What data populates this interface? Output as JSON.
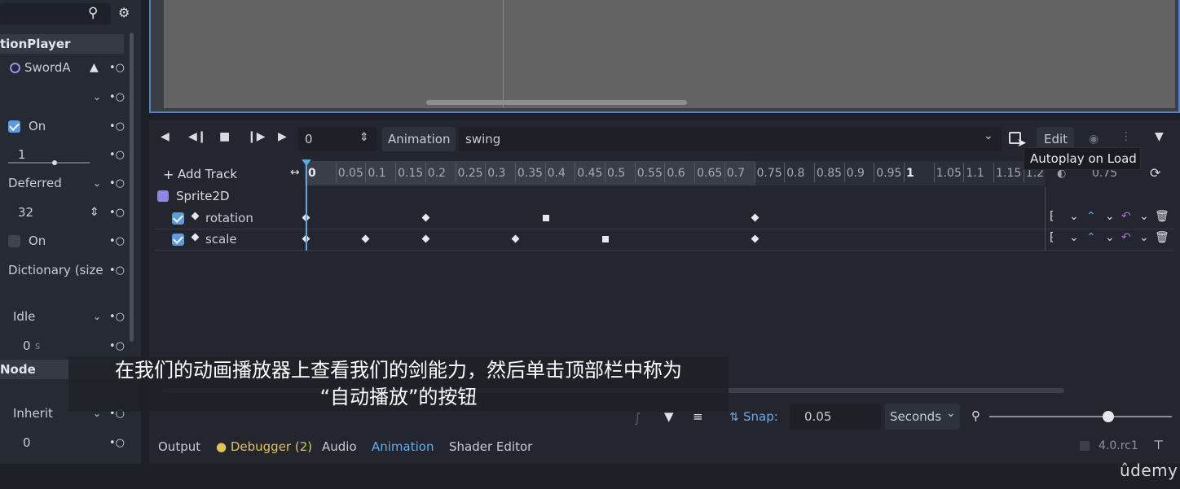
{
  "inspector": {
    "header": "tionPlayer",
    "root_node": "SwordA",
    "autoplay_toggle_label": "On",
    "speed_value": "1",
    "callback_mode": "Deferred",
    "blend_value": "32",
    "reset_toggle_label": "On",
    "libraries": "Dictionary (size",
    "default_anim": "Idle",
    "duration_value": "0",
    "duration_unit": "s",
    "node_section": "Node",
    "process_mode": "Inherit",
    "priority_value": "0"
  },
  "anim": {
    "time_value": "0",
    "animation_label": "Animation",
    "animation_name": "swing",
    "edit_label": "Edit",
    "tooltip": "Autoplay on Load",
    "add_track": "Add Track",
    "ruler_ticks": [
      "0",
      "0.05",
      "0.1",
      "0.15",
      "0.2",
      "0.25",
      "0.3",
      "0.35",
      "0.4",
      "0.45",
      "0.5",
      "0.55",
      "0.6",
      "0.65",
      "0.7",
      "0.75",
      "0.8",
      "0.85",
      "0.9",
      "0.95",
      "1",
      "1.05",
      "1.1",
      "1.15",
      "1.2"
    ],
    "node_name": "Sprite2D",
    "tracks": [
      {
        "name": "rotation",
        "keys": [
          0,
          0.2,
          0.4,
          0.75
        ]
      },
      {
        "name": "scale",
        "keys": [
          0,
          0.1,
          0.2,
          0.35,
          0.5,
          0.75
        ]
      }
    ],
    "snap_label": "Snap:",
    "snap_value": "0.05",
    "snap_unit": "Seconds",
    "partial_tick": "0.75"
  },
  "bottom_tabs": [
    "Output",
    "Debugger (2)",
    "Audio",
    "Animation",
    "Shader Editor"
  ],
  "version": "4.0.rc1",
  "subtitle_line1": "在我们的动画播放器上查看我们的剑能力，然后单击顶部栏中称为",
  "subtitle_line2": "“自动播放”的按钮",
  "watermark": "ûdemy",
  "colors": {
    "accent": "#5aa8ea",
    "checkbox": "#5c9be2",
    "debugger_dot": "#e0c452",
    "active_tab": "#62aef0"
  }
}
